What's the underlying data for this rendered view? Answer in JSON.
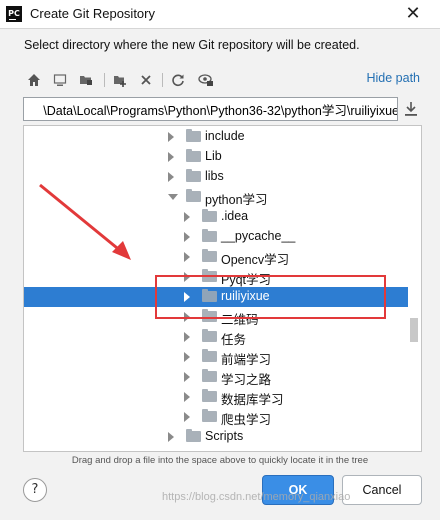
{
  "window": {
    "app_icon_text": "PC",
    "title": "Create Git Repository",
    "close_glyph": "✕"
  },
  "prompt_text": "Select directory where the new Git repository will be created.",
  "toolbar": {
    "buttons": [
      "home-icon",
      "desktop-icon",
      "project-icon",
      "new-folder-icon",
      "delete-icon",
      "refresh-icon",
      "show-hidden-icon"
    ],
    "hide_path_label": "Hide path"
  },
  "path": {
    "value": "\\Data\\Local\\Programs\\Python\\Python36-32\\python学习\\ruiliyixue"
  },
  "tree": {
    "rows": [
      {
        "label": "include",
        "expanded": false,
        "selected": false
      },
      {
        "label": "Lib",
        "expanded": false,
        "selected": false
      },
      {
        "label": "libs",
        "expanded": false,
        "selected": false
      },
      {
        "label": "python学习",
        "expanded": true,
        "selected": false
      },
      {
        "label": ".idea",
        "expanded": false,
        "selected": false
      },
      {
        "label": "__pycache__",
        "expanded": false,
        "selected": false
      },
      {
        "label": "Opencv学习",
        "expanded": false,
        "selected": false
      },
      {
        "label": "Pyqt学习",
        "expanded": false,
        "selected": false
      },
      {
        "label": "ruiliyixue",
        "expanded": false,
        "selected": true
      },
      {
        "label": "二维码",
        "expanded": false,
        "selected": false
      },
      {
        "label": "任务",
        "expanded": false,
        "selected": false
      },
      {
        "label": "前端学习",
        "expanded": false,
        "selected": false
      },
      {
        "label": "学习之路",
        "expanded": false,
        "selected": false
      },
      {
        "label": "数据库学习",
        "expanded": false,
        "selected": false
      },
      {
        "label": "爬虫学习",
        "expanded": false,
        "selected": false
      },
      {
        "label": "Scripts",
        "expanded": false,
        "selected": false
      }
    ]
  },
  "hint_text": "Drag and drop a file into the space above to quickly locate it in the tree",
  "buttons": {
    "help_label": "?",
    "ok_label": "OK",
    "cancel_label": "Cancel"
  },
  "watermark_text": "https://blog.csdn.net/memory_qianxiao",
  "colors": {
    "selection": "#2d7dd2",
    "annotation": "#e2393a",
    "link": "#2470b3",
    "ok_button": "#3a8ee6"
  }
}
